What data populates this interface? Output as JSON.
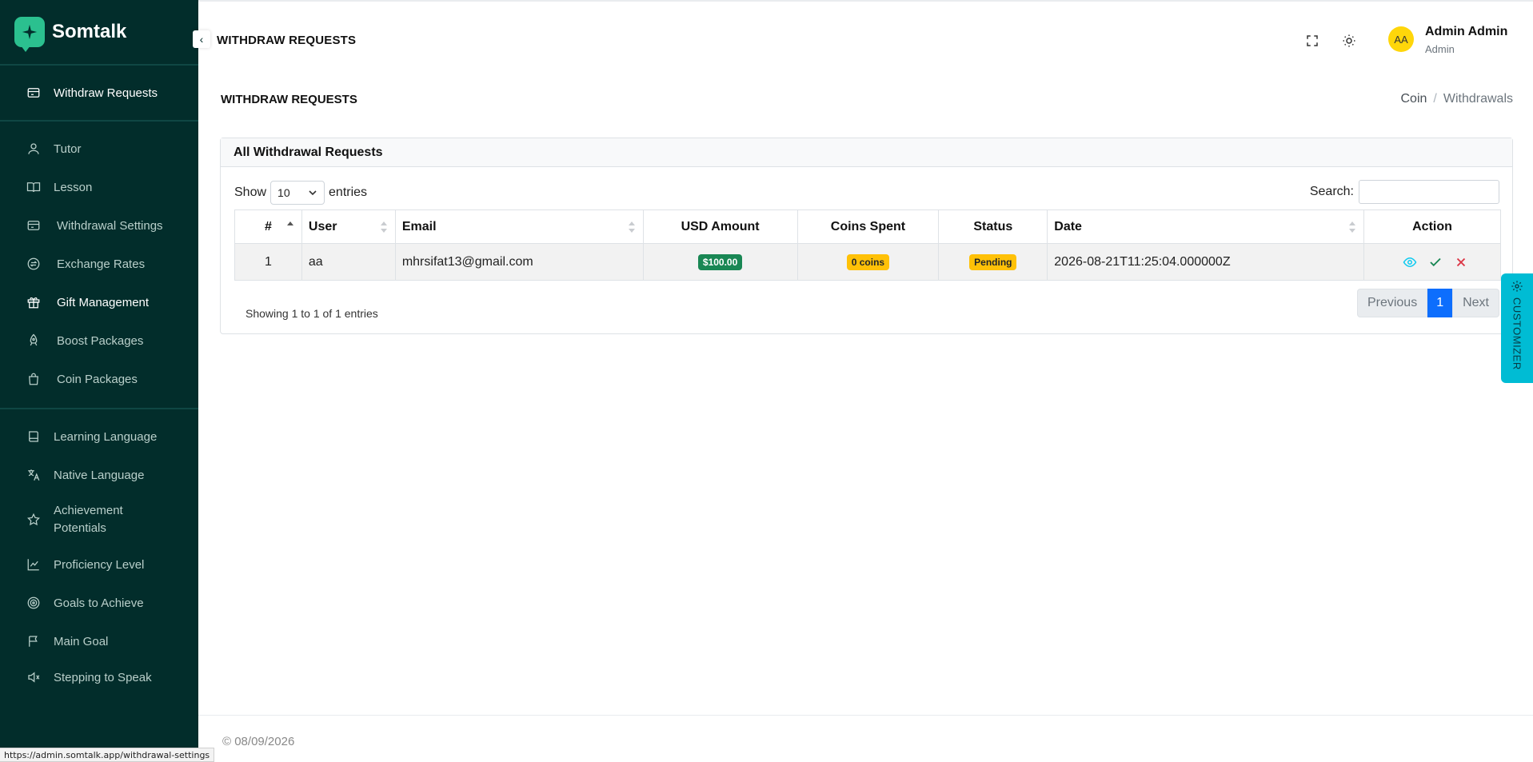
{
  "brand": {
    "name": "Somtalk"
  },
  "sidebar": {
    "items": [
      {
        "label": "Withdraw Requests",
        "icon": "card-icon"
      },
      {
        "label": "Tutor",
        "icon": "user-icon"
      },
      {
        "label": "Lesson",
        "icon": "book-open-icon"
      },
      {
        "label": "Withdrawal Settings",
        "icon": "card-icon"
      },
      {
        "label": "Exchange Rates",
        "icon": "exchange-icon"
      },
      {
        "label": "Gift Management",
        "icon": "gift-icon"
      },
      {
        "label": "Boost Packages",
        "icon": "rocket-icon"
      },
      {
        "label": "Coin Packages",
        "icon": "bag-icon"
      },
      {
        "label": "Learning Language",
        "icon": "book-icon"
      },
      {
        "label": "Native Language",
        "icon": "translate-icon"
      },
      {
        "label": "Achievement Potentials",
        "icon": "star-icon"
      },
      {
        "label": "Proficiency Level",
        "icon": "chart-line-icon"
      },
      {
        "label": "Goals to Achieve",
        "icon": "target-icon"
      },
      {
        "label": "Main Goal",
        "icon": "flag-icon"
      },
      {
        "label": "Stepping to Speak",
        "icon": "speaker-icon"
      }
    ]
  },
  "header": {
    "title": "WITHDRAW REQUESTS",
    "user": {
      "initials": "AA",
      "name": "Admin Admin",
      "role": "Admin"
    }
  },
  "page": {
    "title": "WITHDRAW REQUESTS",
    "breadcrumb": [
      "Coin",
      "Withdrawals"
    ]
  },
  "card": {
    "title": "All Withdrawal Requests",
    "show_label": "Show",
    "entries_label": "entries",
    "page_size": "10",
    "search_label": "Search:",
    "columns": [
      "#",
      "User",
      "Email",
      "USD Amount",
      "Coins Spent",
      "Status",
      "Date",
      "Action"
    ],
    "rows": [
      {
        "index": "1",
        "user": "aa",
        "email": "mhrsifat13@gmail.com",
        "usd_amount": "$100.00",
        "coins_spent": "0 coins",
        "status": "Pending",
        "date": "2026-08-21T11:25:04.000000Z"
      }
    ],
    "info": "Showing 1 to 1 of 1 entries",
    "pagination": {
      "previous": "Previous",
      "current": "1",
      "next": "Next"
    }
  },
  "customizer": {
    "label": "CUSTOMIZER"
  },
  "footer": {
    "text": "© 08/09/2026"
  },
  "statusbar": {
    "url": "https://admin.somtalk.app/withdrawal-settings"
  },
  "colors": {
    "sidebar_bg": "#022d2b",
    "brand_green": "#2bc08f",
    "primary": "#0d6efd",
    "success": "#198754",
    "warning": "#ffc107",
    "customizer": "#00bcd4"
  }
}
